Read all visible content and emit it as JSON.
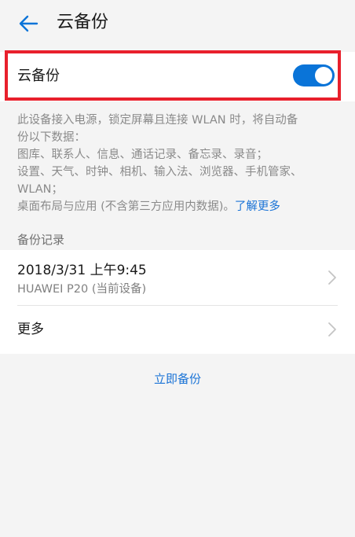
{
  "header": {
    "title": "云备份",
    "back_icon": "arrow-left-icon"
  },
  "toggle": {
    "label": "云备份",
    "enabled": true,
    "accent": "#0a74d8"
  },
  "highlight_color": "#e8202c",
  "description": {
    "lines": [
      "此设备接入电源，锁定屏幕且连接 WLAN 时，将自动备",
      "份以下数据：",
      "图库、联系人、信息、通话记录、备忘录、录音；",
      "设置、天气、时钟、相机、输入法、浏览器、手机管家、",
      "WLAN；"
    ],
    "last_line": "桌面布局与应用 (不含第三方应用内数据)。",
    "link": "了解更多"
  },
  "records": {
    "section_title": "备份记录",
    "latest_time": "2018/3/31 上午9:45",
    "latest_device": "HUAWEI P20 (当前设备)",
    "more_label": "更多",
    "chevron_icon": "chevron-right-icon"
  },
  "actions": {
    "backup_now": "立即备份"
  }
}
